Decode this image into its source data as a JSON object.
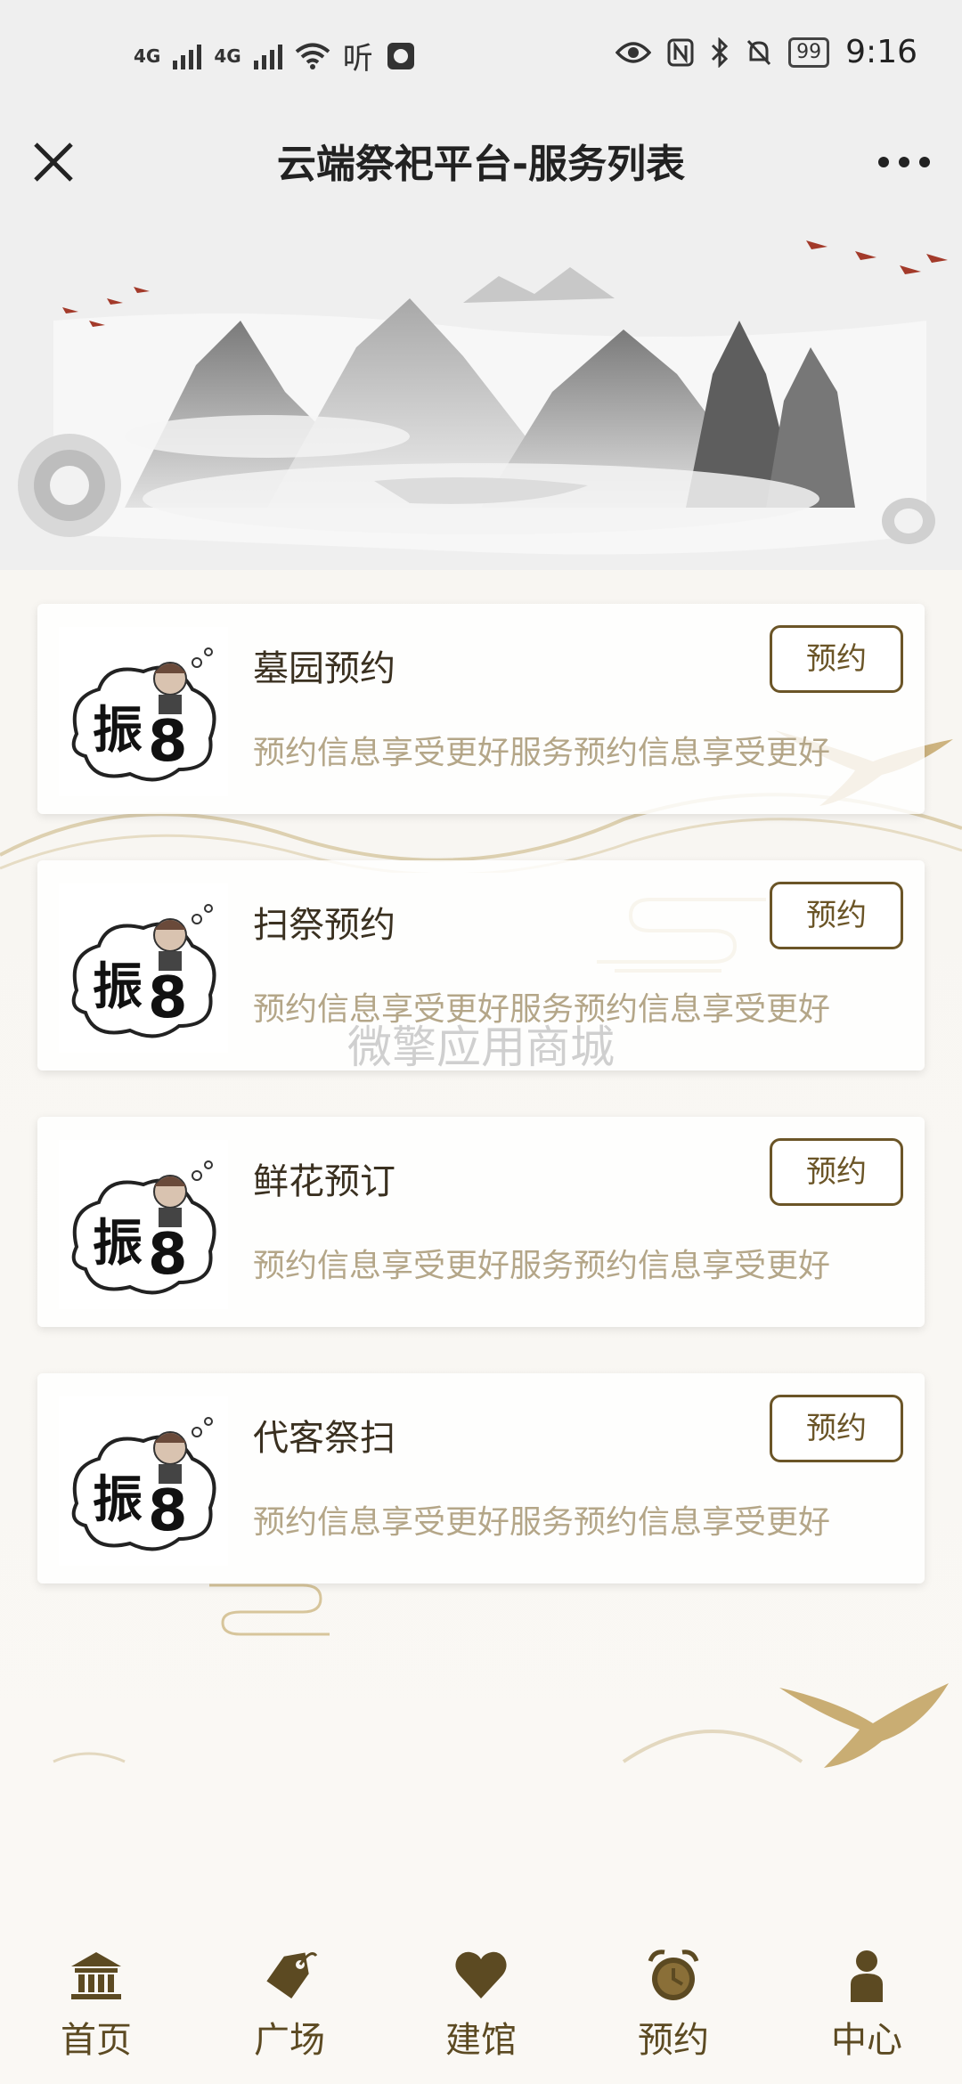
{
  "status_bar": {
    "signal_1": "4G",
    "signal_2": "4G",
    "listen_icon_text": "听",
    "battery": "99",
    "time": "9:16"
  },
  "header": {
    "title": "云端祭祀平台-服务列表",
    "close_icon": "close-icon",
    "more_icon": "more-icon"
  },
  "banner": {
    "description_icon": "landscape-scroll-painting"
  },
  "services": [
    {
      "title": "墓园预约",
      "desc": "预约信息享受更好服务预约信息享受更好",
      "button": "预约"
    },
    {
      "title": "扫祭预约",
      "desc": "预约信息享受更好服务预约信息享受更好",
      "button": "预约"
    },
    {
      "title": "鲜花预订",
      "desc": "预约信息享受更好服务预约信息享受更好",
      "button": "预约"
    },
    {
      "title": "代客祭扫",
      "desc": "预约信息享受更好服务预约信息享受更好",
      "button": "预约"
    }
  ],
  "watermark": "微擎应用商城",
  "tabs": [
    {
      "label": "首页",
      "icon": "temple-icon"
    },
    {
      "label": "广场",
      "icon": "tag-icon"
    },
    {
      "label": "建馆",
      "icon": "heart-icon"
    },
    {
      "label": "预约",
      "icon": "alarm-clock-icon"
    },
    {
      "label": "中心",
      "icon": "user-icon"
    }
  ],
  "colors": {
    "accent": "#6b5527",
    "desc_text": "#b4a688",
    "title_text": "#3a3020"
  }
}
